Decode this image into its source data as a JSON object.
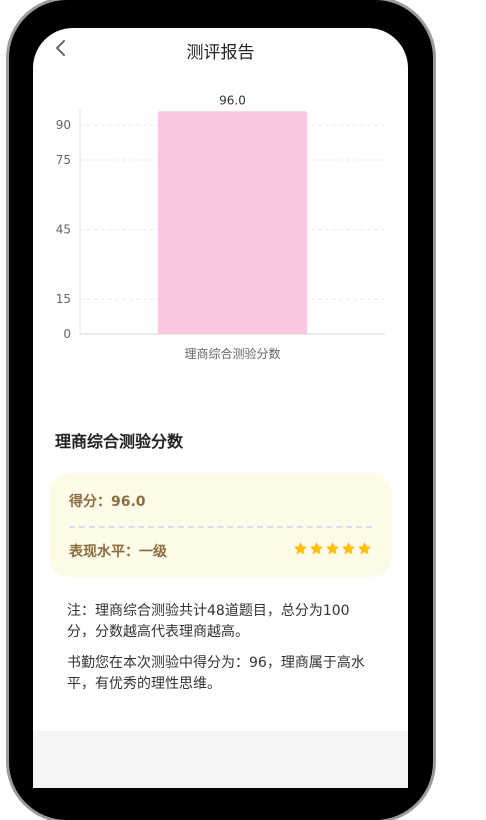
{
  "nav": {
    "title": "测评报告"
  },
  "chart_data": {
    "type": "bar",
    "categories": [
      "理商综合测验分数"
    ],
    "values": [
      96.0
    ],
    "data_labels": [
      "96.0"
    ],
    "y_ticks": [
      0,
      15,
      45,
      75,
      90
    ],
    "ylim": [
      0,
      100
    ],
    "bar_color": "#fcc7e0",
    "grid": true
  },
  "section": {
    "title": "理商综合测验分数"
  },
  "score_card": {
    "score_label": "得分：",
    "score_value": "96.0",
    "level_label": "表现水平：",
    "level_value": "一级",
    "stars": 5,
    "star_color": "#ffbf00"
  },
  "notes": {
    "line1": "注：理商综合测验共计48道题目，总分为100分，分数越高代表理商越高。",
    "line2": "书勤您在本次测验中得分为：96，理商属于高水平，有优秀的理性思维。"
  }
}
